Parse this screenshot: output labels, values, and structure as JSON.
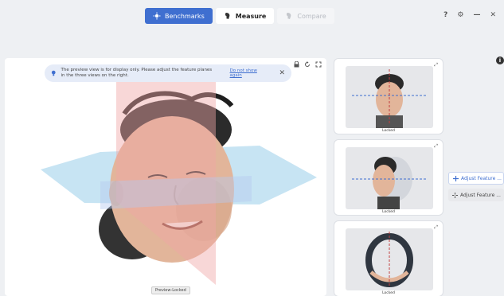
{
  "tabs": [
    {
      "label": "Benchmarks",
      "state": "active"
    },
    {
      "label": "Measure",
      "state": "normal"
    },
    {
      "label": "Compare",
      "state": "disabled"
    }
  ],
  "window_controls": {
    "help": "?",
    "settings": "⚙",
    "minimize": "—",
    "close": "✕"
  },
  "notice": {
    "text": "The preview view is for display only. Please adjust the feature planes in the three views on the right.",
    "link": "Do not show again",
    "close": "✕"
  },
  "viewer": {
    "preview_label": "Preview-Locked"
  },
  "thumbnails": [
    {
      "label": "Locked",
      "view": "front"
    },
    {
      "label": "Locked",
      "view": "side"
    },
    {
      "label": "Locked",
      "view": "top"
    }
  ],
  "right_panel": {
    "info": "i",
    "adjust_primary": "Adjust Feature ...",
    "adjust_secondary": "Adjust Feature ..."
  },
  "colors": {
    "accent": "#3f6fd0",
    "plane_red": "#f0a6a6",
    "plane_blue": "#a9d6ec"
  }
}
